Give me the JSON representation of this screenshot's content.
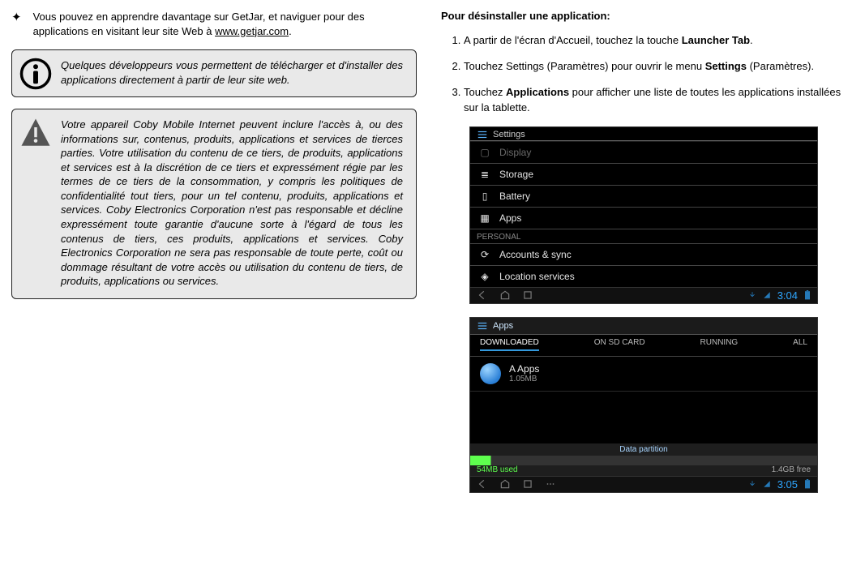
{
  "left": {
    "bullet": "Vous pouvez en apprendre davantage sur GetJar, et naviguer pour des applications en visitant leur site Web à ",
    "bullet_link": "www.getjar.com",
    "bullet_tail": ".",
    "info_box": "Quelques développeurs vous permettent de télécharger et d'installer des applications directement à partir de leur site web.",
    "warn_box": "Votre appareil Coby Mobile Internet peuvent inclure l'accès à, ou des informations sur, contenus, produits, applications et services de tierces parties. Votre utilisation du contenu de ce tiers, de produits, applications et services est à la discrétion de ce tiers et expressément régie par les termes de ce tiers de la consommation, y compris les politiques de confidentialité tout tiers, pour un tel contenu, produits, applications et services. Coby Electronics Corporation n'est pas responsable et décline expressément toute garantie d'aucune sorte à l'égard de tous les contenus de tiers, ces produits, applications et services. Coby Electronics Corporation ne sera pas responsable de toute perte, coût ou dommage résultant de votre accès ou utilisation du contenu de tiers, de produits, applications ou services."
  },
  "right": {
    "heading": "Pour désinstaller une application:",
    "steps": {
      "s1_a": "A partir de l'écran d'Accueil, touchez la touche ",
      "s1_b": "Launcher Tab",
      "s1_c": ".",
      "s2_a": "Touchez Settings (Paramètres) pour ouvrir le menu ",
      "s2_b": "Settings",
      "s2_c": " (Paramètres).",
      "s3_a": "Touchez ",
      "s3_b": "Applications",
      "s3_c": " pour afficher une liste de toutes les applications installées sur la tablette."
    }
  },
  "shot1": {
    "title": "Settings",
    "display": "Display",
    "storage": "Storage",
    "battery": "Battery",
    "apps": "Apps",
    "personal": "PERSONAL",
    "accounts": "Accounts & sync",
    "location": "Location services",
    "clock": "3:04"
  },
  "shot2": {
    "title": "Apps",
    "tabs": {
      "dl": "DOWNLOADED",
      "sd": "ON SD CARD",
      "run": "RUNNING",
      "all": "ALL"
    },
    "app_name": "A Apps",
    "app_size": "1.05MB",
    "datapartition": "Data partition",
    "used": "54MB used",
    "free": "1.4GB free",
    "clock": "3:05"
  }
}
